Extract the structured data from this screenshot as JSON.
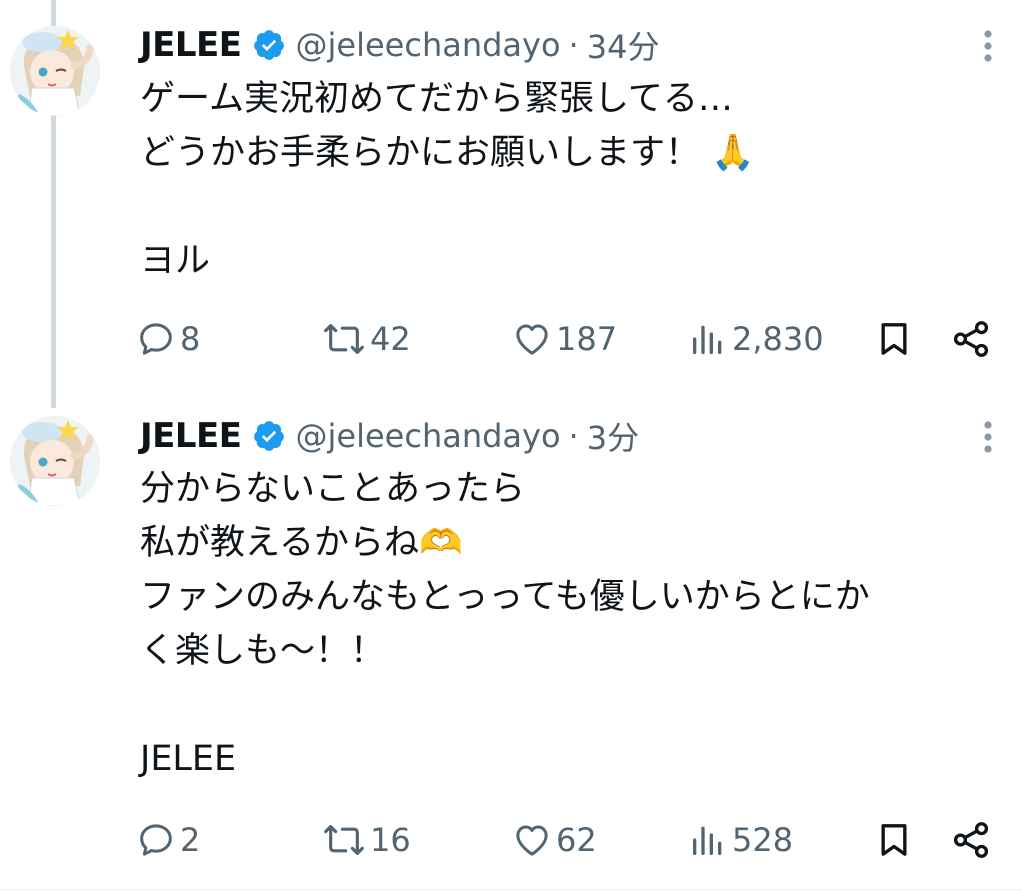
{
  "tweets": [
    {
      "name": "JELEE",
      "handle": "@jeleechandayo",
      "separator": "·",
      "time": "34分",
      "lines": [
        "ゲーム実況初めてだから緊張してる…",
        "どうかお手柔らかにお願いします！ 🙏",
        "",
        "ヨル"
      ],
      "replies": "8",
      "retweets": "42",
      "likes": "187",
      "views": "2,830"
    },
    {
      "name": "JELEE",
      "handle": "@jeleechandayo",
      "separator": "·",
      "time": "3分",
      "lines": [
        "分からないことあったら",
        "私が教えるからね🫶",
        "ファンのみんなもとっっても優しいからとにか",
        "く楽しも〜！！",
        "",
        "JELEE"
      ],
      "replies": "2",
      "retweets": "16",
      "likes": "62",
      "views": "528"
    }
  ],
  "icons": {
    "verified": "verified-badge-icon",
    "more": "more-vertical-icon",
    "reply": "reply-icon",
    "retweet": "retweet-icon",
    "like": "heart-icon",
    "views": "views-chart-icon",
    "bookmark": "bookmark-icon",
    "share": "share-icon"
  },
  "colors": {
    "verified": "#1d9bf0",
    "text": "#0f1419",
    "muted": "#536471",
    "thread_line": "#cfd9de"
  }
}
